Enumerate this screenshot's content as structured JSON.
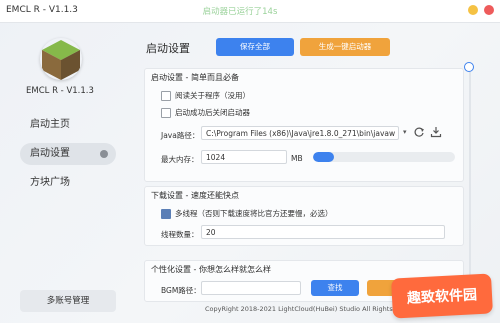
{
  "window": {
    "title": "EMCL R - V1.1.3",
    "banner": "启动器已运行了14s"
  },
  "sidebar": {
    "version": "EMCL R - V1.1.3",
    "items": [
      {
        "label": "启动主页"
      },
      {
        "label": "启动设置"
      },
      {
        "label": "方块广场"
      }
    ],
    "account_button": "多账号管理"
  },
  "main": {
    "title": "启动设置",
    "save_all": "保存全部",
    "gen_launcher": "生成一键启动器"
  },
  "launch_panel": {
    "title": "启动设置 - 简单而且必备",
    "option1": "阅读关于程序（没用）",
    "option2": "启动成功后关闭启动器",
    "java_label": "Java路径：",
    "java_value": "C:\\Program Files (x86)\\Java\\jre1.8.0_271\\bin\\javaw",
    "mem_label": "最大内存：",
    "mem_value": "1024",
    "mem_unit": "MB",
    "mem_level": 0.15
  },
  "download_panel": {
    "title": "下载设置 - 速度还能快点",
    "multithread": "多线程（否则下载速度将比官方还要慢，必选）",
    "thread_label": "线程数量：",
    "thread_value": "20"
  },
  "personal_panel": {
    "title": "个性化设置 - 你想怎么样就怎么样",
    "bgm_label": "BGM路径：",
    "find_button": "查找"
  },
  "footer": "CopyRight 2018-2021 LightCloud(HuBei) Studio All Rights Reserved",
  "watermark": "趣致软件园",
  "colors": {
    "accent": "#3d82ee",
    "orange": "#f0a33c"
  }
}
